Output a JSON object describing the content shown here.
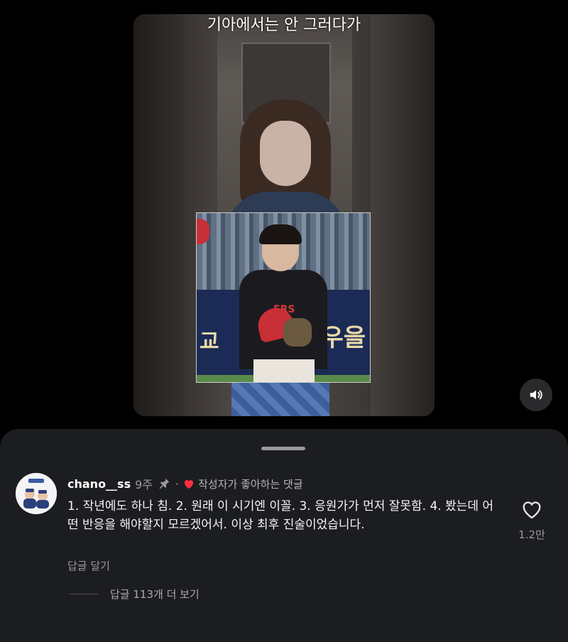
{
  "video": {
    "caption": "기아에서는 안 그러다가",
    "inset_banner_left": "교",
    "inset_banner_right": "우을",
    "jersey_text": "ERS"
  },
  "sound_button": {
    "icon": "speaker-volume-icon"
  },
  "comment": {
    "username": "chano__ss",
    "time_ago": "9주",
    "pin_icon": "pin-icon",
    "separator": "·",
    "author_liked_label": "작성자가 좋아하는 댓글",
    "text": "1. 작년에도 하나 침. 2. 원래 이 시기엔 이꼴. 3. 응원가가 먼저 잘못함. 4. 봤는데 어떤 반응을 해야할지 모르겠어서. 이상 최후 진술이었습니다.",
    "reply_label": "답글 달기",
    "like_count": "1.2만",
    "view_replies_label": "답글 113개 더 보기",
    "colors": {
      "heart": "#ff3040",
      "sheet_bg": "#1c1d20"
    }
  }
}
